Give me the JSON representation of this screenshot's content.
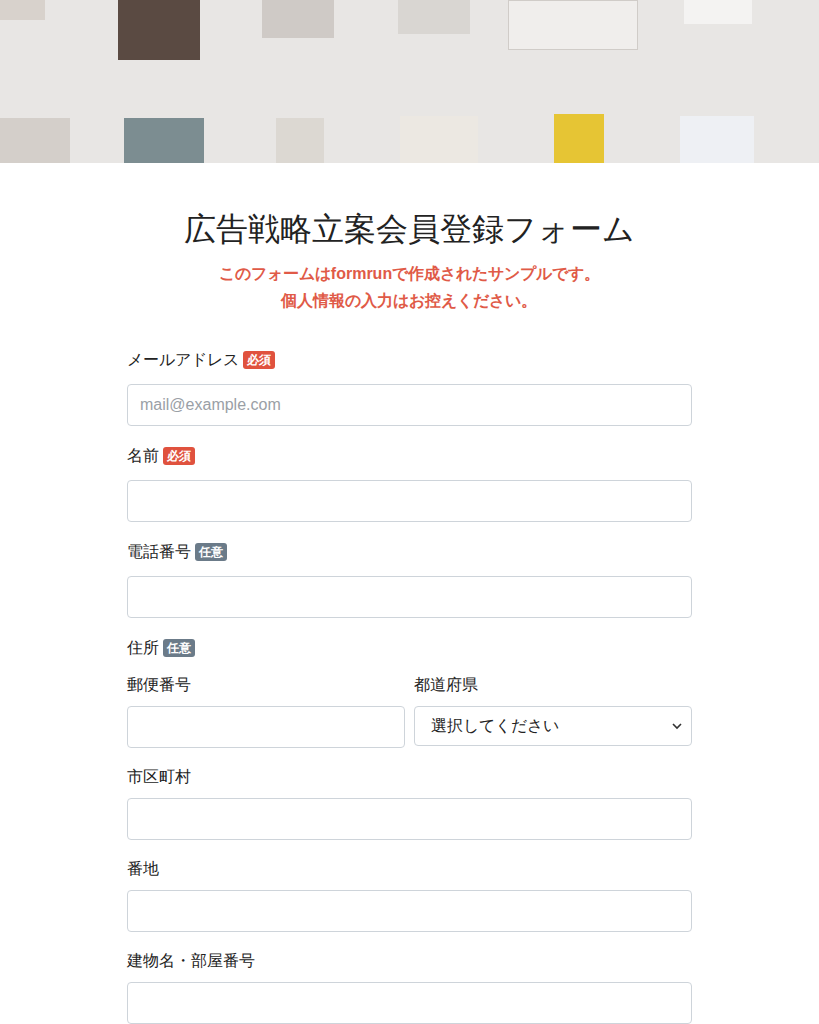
{
  "form": {
    "title": "広告戦略立案会員登録フォーム",
    "notice": [
      "このフォームはformrunで作成されたサンプルです。",
      "個人情報の入力はお控えください。"
    ]
  },
  "fields": [
    {
      "label": "メールアドレス",
      "badge": "必須",
      "required": true,
      "placeholder": "mail@example.com"
    },
    {
      "label": "名前",
      "badge": "必須",
      "required": true
    },
    {
      "label": "電話番号",
      "badge": "任意",
      "required": false
    }
  ],
  "address": {
    "label": "住所",
    "badge": "任意",
    "required": false,
    "postal_label": "郵便番号",
    "prefecture_label": "都道府県",
    "prefecture_value": "選択してください",
    "lines": [
      "市区町村",
      "番地",
      "建物名・部屋番号"
    ]
  }
}
